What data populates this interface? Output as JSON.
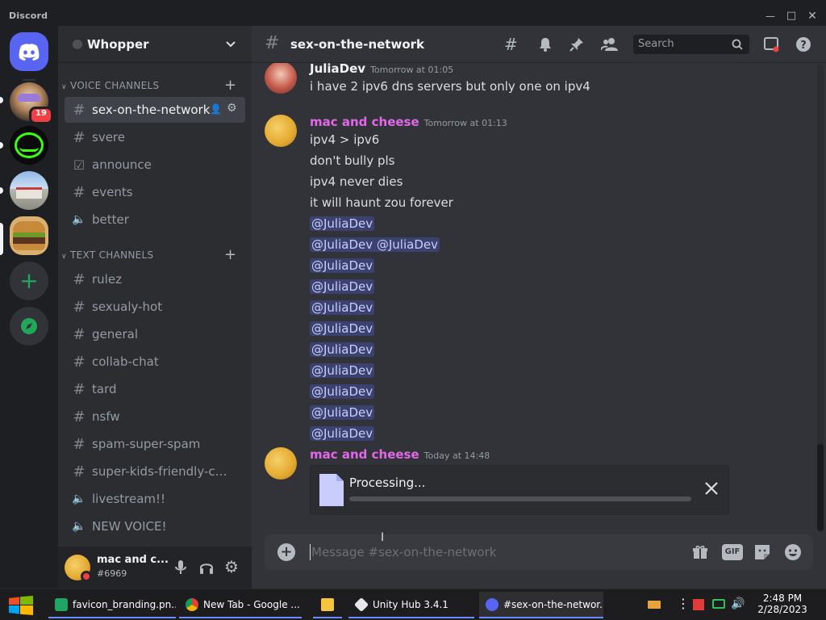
{
  "app_title": "Discord",
  "servers": [
    {
      "name": "server-with-badge",
      "badge": "19"
    },
    {
      "name": "troll-server"
    },
    {
      "name": "building-server"
    },
    {
      "name": "burger-server"
    }
  ],
  "server_name": "Whopper",
  "categories": {
    "voice": "VOICE CHANNELS",
    "text": "TEXT CHANNELS"
  },
  "voice_channels": [
    {
      "label": "sex-on-the-network",
      "icon": "hash-icon",
      "active": true
    },
    {
      "label": "svere",
      "icon": "hash-icon"
    },
    {
      "label": "announce",
      "icon": "checkbox-icon"
    },
    {
      "label": "events",
      "icon": "hash-icon"
    },
    {
      "label": "better",
      "icon": "speaker-icon"
    }
  ],
  "text_channels": [
    {
      "label": "rulez",
      "icon": "hash-icon"
    },
    {
      "label": "sexualy-hot",
      "icon": "hash-locked-icon"
    },
    {
      "label": "general",
      "icon": "hash-icon"
    },
    {
      "label": "collab-chat",
      "icon": "hash-icon"
    },
    {
      "label": "tard",
      "icon": "hash-icon"
    },
    {
      "label": "nsfw",
      "icon": "hash-nsfw-icon"
    },
    {
      "label": "spam-super-spam",
      "icon": "hash-icon"
    },
    {
      "label": "super-kids-friendly-ch...",
      "icon": "hash-icon"
    },
    {
      "label": "livestream!!",
      "icon": "speaker-icon"
    },
    {
      "label": "NEW VOICE!",
      "icon": "speaker-icon"
    }
  ],
  "user": {
    "name": "mac and c...",
    "tag": "#6969"
  },
  "channel_header": {
    "name": "sex-on-the-network",
    "search_placeholder": "Search"
  },
  "messages": [
    {
      "author": "JuliaDev",
      "author_color": "#f2f3f5",
      "timestamp": "Tomorrow at 01:05",
      "lines": [
        "i have 2 ipv6 dns servers but only one on ipv4"
      ]
    },
    {
      "author": "mac and cheese",
      "author_color": "#e069e8",
      "timestamp": "Tomorrow at 01:13",
      "lines": [
        "ipv4 > ipv6",
        "don't bully pls",
        "ipv4 never dies",
        "it will haunt zou forever"
      ],
      "mentions": [
        "@JuliaDev",
        "@JuliaDev @JuliaDev",
        "@JuliaDev",
        "@JuliaDev",
        "@JuliaDev",
        "@JuliaDev",
        "@JuliaDev",
        "@JuliaDev",
        "@JuliaDev",
        "@JuliaDev",
        "@JuliaDev"
      ]
    },
    {
      "author": "mac and cheese",
      "author_color": "#e069e8",
      "timestamp": "Today at 14:48"
    }
  ],
  "upload": {
    "status": "Processing...",
    "progress": 0
  },
  "composer_placeholder": "Message #sex-on-the-network",
  "taskbar": {
    "items": [
      {
        "label": "favicon_branding.pn...",
        "icon": "spreadsheet-icon"
      },
      {
        "label": "New Tab - Google ...",
        "icon": "chrome-icon"
      },
      {
        "label": "",
        "icon": "folder-icon"
      },
      {
        "label": "Unity Hub 3.4.1",
        "icon": "unity-icon"
      },
      {
        "label": "#sex-on-the-networ...",
        "icon": "discord-icon"
      }
    ],
    "time": "2:48 PM",
    "date": "2/28/2023"
  },
  "colors": {
    "accent": "#5865f2",
    "mention_bg": "#3c4270",
    "online": "#23a55a",
    "dnd": "#f23f43"
  }
}
